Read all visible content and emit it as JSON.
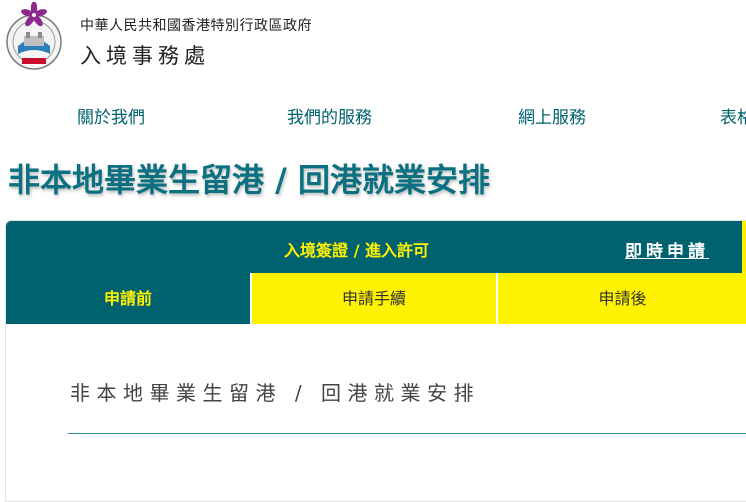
{
  "header": {
    "gov_name": "中華人民共和國香港特別行政區政府",
    "dept_name": "入境事務處"
  },
  "nav": {
    "items": [
      {
        "label": "關於我們"
      },
      {
        "label": "我們的服務"
      },
      {
        "label": "網上服務"
      },
      {
        "label": "表格"
      }
    ]
  },
  "page": {
    "title": "非本地畢業生留港 / 回港就業安排"
  },
  "panel": {
    "header_title": "入境簽證 / 進入許可",
    "apply_link": "即時申請",
    "tabs": [
      {
        "label": "申請前",
        "active": true
      },
      {
        "label": "申請手續",
        "active": false
      },
      {
        "label": "申請後",
        "active": false
      }
    ],
    "content_title": "非本地畢業生留港 / 回港就業安排"
  },
  "colors": {
    "teal": "#00626e",
    "title_teal": "#0b7181",
    "yellow": "#fff200"
  }
}
